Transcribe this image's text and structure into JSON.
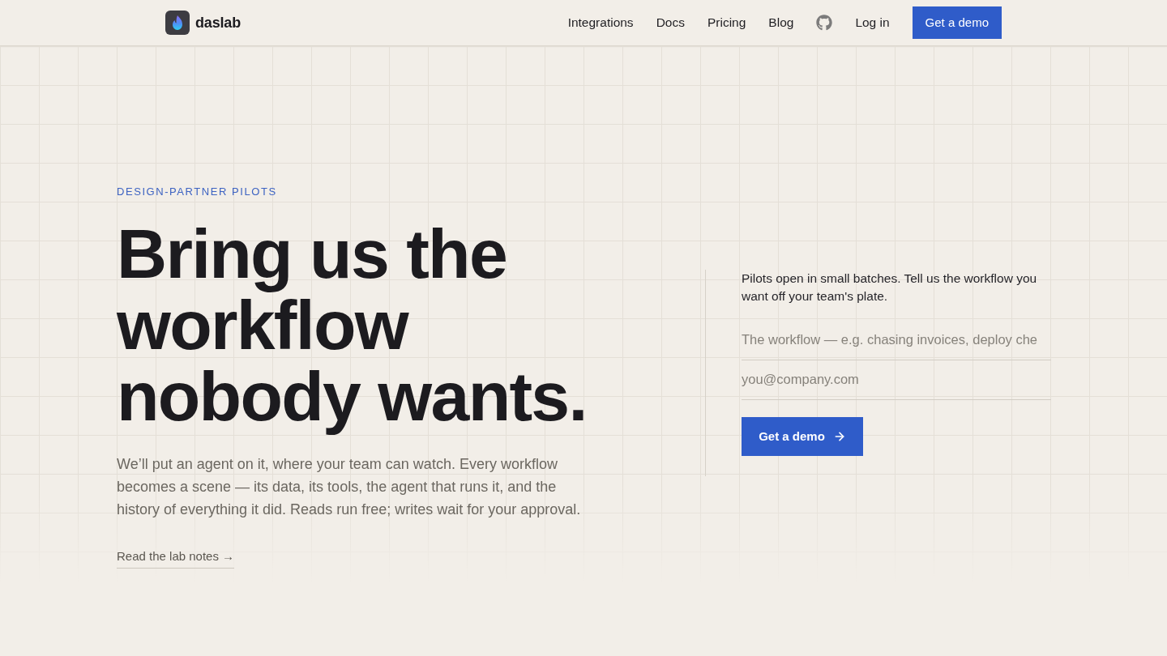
{
  "header": {
    "brand": "daslab",
    "nav": [
      {
        "label": "Integrations"
      },
      {
        "label": "Docs"
      },
      {
        "label": "Pricing"
      },
      {
        "label": "Blog"
      }
    ],
    "login": "Log in",
    "cta": "Get a demo"
  },
  "hero": {
    "eyebrow": "DESIGN-PARTNER PILOTS",
    "headline": "Bring us the workflow nobody wants.",
    "body_lines": [
      "We’ll put an agent on it, where your team can watch. Every workflow",
      "becomes a scene — its data, its tools, the agent that runs it, and the",
      "history of everything it did. Reads run free; writes wait for your approval."
    ],
    "link": "Read the lab notes →"
  },
  "form": {
    "intro": "Pilots open in small batches. Tell us the workflow you want off your team's plate.",
    "fields": [
      {
        "placeholder": "The workflow — e.g. chasing invoices, deploy che"
      },
      {
        "placeholder": "you@company.com"
      }
    ],
    "submit": "Get a demo"
  }
}
